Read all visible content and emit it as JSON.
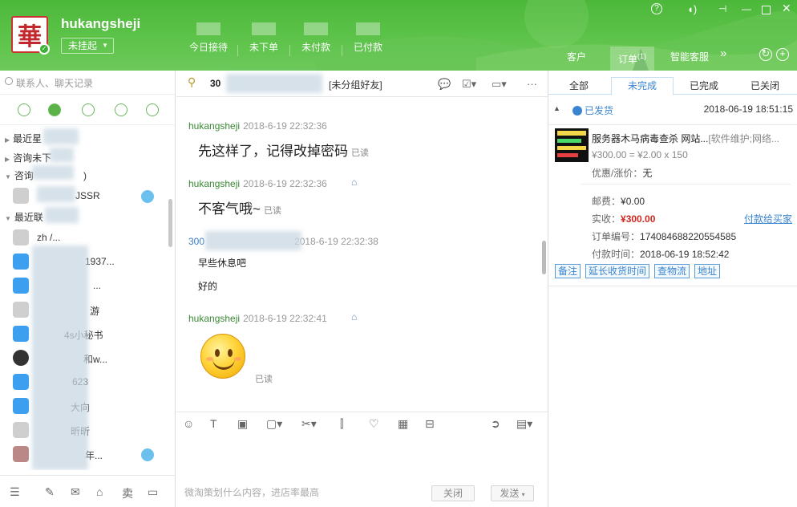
{
  "header": {
    "username": "hukangsheji",
    "status_label": "未挂起",
    "stats": [
      {
        "label": "今日接待"
      },
      {
        "label": "未下单"
      },
      {
        "label": "未付款"
      },
      {
        "label": "已付款"
      }
    ],
    "tabs": [
      {
        "label": "客户"
      },
      {
        "label": "订单",
        "count": "(1)"
      },
      {
        "label": "智能客服"
      }
    ],
    "more_glyph": "»"
  },
  "search": {
    "placeholder": "联系人、聊天记录"
  },
  "contacts": {
    "groups": [
      {
        "label": "最近星"
      },
      {
        "label": "咨询未下"
      },
      {
        "label": "咨询",
        "suffix": ")"
      },
      {
        "label": "最近联"
      }
    ],
    "items": [
      {
        "name": "JSSR",
        "avatar": "gray"
      },
      {
        "name": "zh /...",
        "avatar": "gray"
      },
      {
        "name": "1937...",
        "avatar": "blue"
      },
      {
        "name": "...",
        "avatar": "blue"
      },
      {
        "name": "游",
        "avatar": "gray"
      },
      {
        "name": "4s小秘书",
        "avatar": "blue"
      },
      {
        "name": "和w...",
        "avatar": "dark"
      },
      {
        "name": "623",
        "avatar": "blue"
      },
      {
        "name": "大向",
        "avatar": "blue"
      },
      {
        "name": "昕昕",
        "avatar": "gray"
      },
      {
        "name": "年...",
        "avatar": "photo"
      }
    ]
  },
  "chat": {
    "title_prefix": "30",
    "group_label": "[未分组好友]",
    "messages": [
      {
        "sender": "hukangsheji",
        "time": "2018-6-19 22:32:36",
        "text": "先这样了，记得改掉密码",
        "read": "已读"
      },
      {
        "sender": "hukangsheji",
        "time": "2018-6-19 22:32:36",
        "text": "不客气哦~",
        "read": "已读"
      },
      {
        "sender": "300",
        "time": "2018-6-19 22:32:38",
        "text": "早些休息吧",
        "text2": "好的"
      },
      {
        "sender": "hukangsheji",
        "time": "2018-6-19 22:32:41",
        "read": "已读"
      }
    ],
    "input_hint": "微淘策划什么内容，进店率最高",
    "close_label": "关闭",
    "send_label": "发送"
  },
  "order_panel": {
    "tabs": [
      "全部",
      "未完成",
      "已完成",
      "已关闭"
    ],
    "active_tab": "未完成",
    "status": "已发货",
    "order_time": "2018-06-19 18:51:15",
    "product_title": "服务器木马病毒查杀 网站...",
    "product_tags": "[软件维护;网络...",
    "price_line": "¥300.00 = ¥2.00 x 150",
    "discount_label": "优惠/涨价：",
    "discount_value": "无",
    "postage_label": "邮费：",
    "postage_value": "¥0.00",
    "paid_label": "实收：",
    "paid_value": "¥300.00",
    "refund_link": "付款给买家",
    "order_no_label": "订单编号：",
    "order_no": "174084688220554585",
    "pay_time_label": "付款时间：",
    "pay_time": "2018-06-19 18:52:42",
    "actions": [
      "备注",
      "延长收货时间",
      "查物流",
      "地址"
    ]
  }
}
